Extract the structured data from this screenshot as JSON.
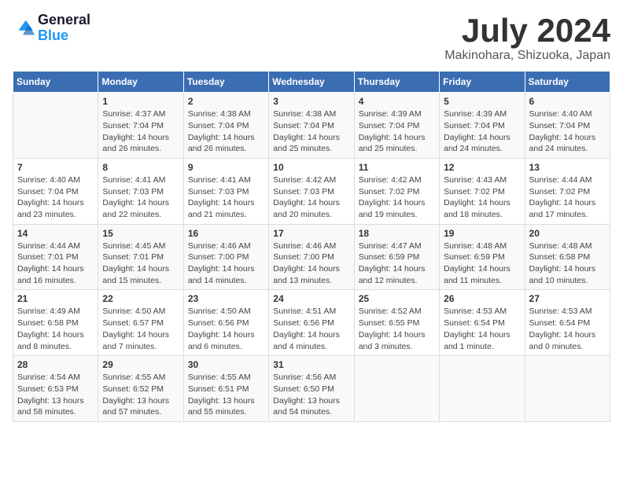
{
  "logo": {
    "line1": "General",
    "line2": "Blue"
  },
  "title": "July 2024",
  "location": "Makinohara, Shizuoka, Japan",
  "days_of_week": [
    "Sunday",
    "Monday",
    "Tuesday",
    "Wednesday",
    "Thursday",
    "Friday",
    "Saturday"
  ],
  "weeks": [
    [
      {
        "day": "",
        "info": ""
      },
      {
        "day": "1",
        "info": "Sunrise: 4:37 AM\nSunset: 7:04 PM\nDaylight: 14 hours\nand 26 minutes."
      },
      {
        "day": "2",
        "info": "Sunrise: 4:38 AM\nSunset: 7:04 PM\nDaylight: 14 hours\nand 26 minutes."
      },
      {
        "day": "3",
        "info": "Sunrise: 4:38 AM\nSunset: 7:04 PM\nDaylight: 14 hours\nand 25 minutes."
      },
      {
        "day": "4",
        "info": "Sunrise: 4:39 AM\nSunset: 7:04 PM\nDaylight: 14 hours\nand 25 minutes."
      },
      {
        "day": "5",
        "info": "Sunrise: 4:39 AM\nSunset: 7:04 PM\nDaylight: 14 hours\nand 24 minutes."
      },
      {
        "day": "6",
        "info": "Sunrise: 4:40 AM\nSunset: 7:04 PM\nDaylight: 14 hours\nand 24 minutes."
      }
    ],
    [
      {
        "day": "7",
        "info": "Sunrise: 4:40 AM\nSunset: 7:04 PM\nDaylight: 14 hours\nand 23 minutes."
      },
      {
        "day": "8",
        "info": "Sunrise: 4:41 AM\nSunset: 7:03 PM\nDaylight: 14 hours\nand 22 minutes."
      },
      {
        "day": "9",
        "info": "Sunrise: 4:41 AM\nSunset: 7:03 PM\nDaylight: 14 hours\nand 21 minutes."
      },
      {
        "day": "10",
        "info": "Sunrise: 4:42 AM\nSunset: 7:03 PM\nDaylight: 14 hours\nand 20 minutes."
      },
      {
        "day": "11",
        "info": "Sunrise: 4:42 AM\nSunset: 7:02 PM\nDaylight: 14 hours\nand 19 minutes."
      },
      {
        "day": "12",
        "info": "Sunrise: 4:43 AM\nSunset: 7:02 PM\nDaylight: 14 hours\nand 18 minutes."
      },
      {
        "day": "13",
        "info": "Sunrise: 4:44 AM\nSunset: 7:02 PM\nDaylight: 14 hours\nand 17 minutes."
      }
    ],
    [
      {
        "day": "14",
        "info": "Sunrise: 4:44 AM\nSunset: 7:01 PM\nDaylight: 14 hours\nand 16 minutes."
      },
      {
        "day": "15",
        "info": "Sunrise: 4:45 AM\nSunset: 7:01 PM\nDaylight: 14 hours\nand 15 minutes."
      },
      {
        "day": "16",
        "info": "Sunrise: 4:46 AM\nSunset: 7:00 PM\nDaylight: 14 hours\nand 14 minutes."
      },
      {
        "day": "17",
        "info": "Sunrise: 4:46 AM\nSunset: 7:00 PM\nDaylight: 14 hours\nand 13 minutes."
      },
      {
        "day": "18",
        "info": "Sunrise: 4:47 AM\nSunset: 6:59 PM\nDaylight: 14 hours\nand 12 minutes."
      },
      {
        "day": "19",
        "info": "Sunrise: 4:48 AM\nSunset: 6:59 PM\nDaylight: 14 hours\nand 11 minutes."
      },
      {
        "day": "20",
        "info": "Sunrise: 4:48 AM\nSunset: 6:58 PM\nDaylight: 14 hours\nand 10 minutes."
      }
    ],
    [
      {
        "day": "21",
        "info": "Sunrise: 4:49 AM\nSunset: 6:58 PM\nDaylight: 14 hours\nand 8 minutes."
      },
      {
        "day": "22",
        "info": "Sunrise: 4:50 AM\nSunset: 6:57 PM\nDaylight: 14 hours\nand 7 minutes."
      },
      {
        "day": "23",
        "info": "Sunrise: 4:50 AM\nSunset: 6:56 PM\nDaylight: 14 hours\nand 6 minutes."
      },
      {
        "day": "24",
        "info": "Sunrise: 4:51 AM\nSunset: 6:56 PM\nDaylight: 14 hours\nand 4 minutes."
      },
      {
        "day": "25",
        "info": "Sunrise: 4:52 AM\nSunset: 6:55 PM\nDaylight: 14 hours\nand 3 minutes."
      },
      {
        "day": "26",
        "info": "Sunrise: 4:53 AM\nSunset: 6:54 PM\nDaylight: 14 hours\nand 1 minute."
      },
      {
        "day": "27",
        "info": "Sunrise: 4:53 AM\nSunset: 6:54 PM\nDaylight: 14 hours\nand 0 minutes."
      }
    ],
    [
      {
        "day": "28",
        "info": "Sunrise: 4:54 AM\nSunset: 6:53 PM\nDaylight: 13 hours\nand 58 minutes."
      },
      {
        "day": "29",
        "info": "Sunrise: 4:55 AM\nSunset: 6:52 PM\nDaylight: 13 hours\nand 57 minutes."
      },
      {
        "day": "30",
        "info": "Sunrise: 4:55 AM\nSunset: 6:51 PM\nDaylight: 13 hours\nand 55 minutes."
      },
      {
        "day": "31",
        "info": "Sunrise: 4:56 AM\nSunset: 6:50 PM\nDaylight: 13 hours\nand 54 minutes."
      },
      {
        "day": "",
        "info": ""
      },
      {
        "day": "",
        "info": ""
      },
      {
        "day": "",
        "info": ""
      }
    ]
  ]
}
